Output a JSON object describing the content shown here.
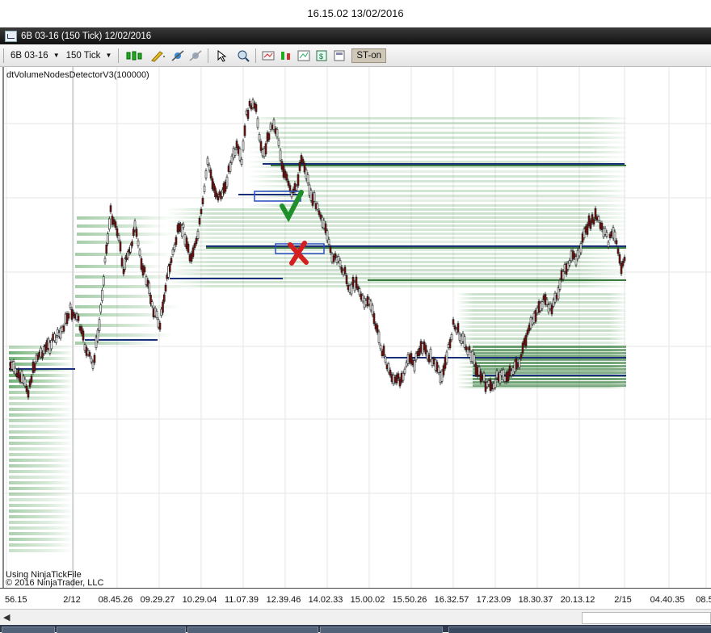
{
  "screen_timestamp": "16.15.02 13/02/2016",
  "window": {
    "title": "6B 03-16 (150 Tick)  12/02/2016"
  },
  "toolbar": {
    "instrument": "6B 03-16",
    "interval": "150 Tick",
    "st_label": "ST-on",
    "icons": [
      "candlestick-style-icon",
      "drawing-pencil-icon",
      "add-indicator-icon",
      "remove-indicator-icon",
      "pointer-icon",
      "zoom-icon",
      "strategies-icon",
      "indicators-icon",
      "chart-properties-icon",
      "data-box-icon",
      "window-linking-icon"
    ]
  },
  "chart": {
    "indicator_label": "dtVolumeNodesDetectorV3(100000)",
    "credit_line1": "Using NinjaTickFile",
    "credit_line2": "© 2016 NinjaTrader, LLC",
    "colors": {
      "volume_node": "#1f7a2a",
      "volume_node_strong": "#0d5a12",
      "poc_line": "#1a2f7a",
      "candle": "#1a1a1a",
      "candle_down": "#7a1010",
      "check_mark": "#2aa832",
      "cross_mark": "#d42020",
      "highlight_box": "#2a4fc0"
    },
    "x_labels": [
      "56.15",
      "2/12",
      "08.45.26",
      "09.29.27",
      "10.29.04",
      "11.07.39",
      "12.39.46",
      "14.02.33",
      "15.00.02",
      "15.50.26",
      "16.32.57",
      "17.23.09",
      "18.30.37",
      "20.13.12",
      "2/15",
      "04.40.35",
      "08.5"
    ]
  },
  "taskbar": {
    "items": 5
  }
}
